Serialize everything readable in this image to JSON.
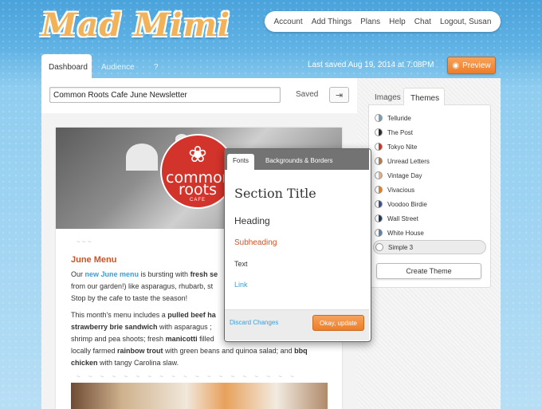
{
  "app": {
    "logo": "Mad Mimi"
  },
  "topnav": [
    "Account",
    "Add Things",
    "Plans",
    "Help",
    "Chat",
    "Logout, Susan"
  ],
  "tabs": {
    "dashboard": "Dashboard",
    "audience": "Audience",
    "help": "?"
  },
  "status": {
    "last_saved": "Last saved Aug 19, 2014 at 7:08PM",
    "preview": "Preview"
  },
  "editor": {
    "title_value": "Common Roots Cafe June Newsletter",
    "saved": "Saved",
    "exit_icon": "exit-icon"
  },
  "sidebar": {
    "tabs": [
      "Images",
      "Themes"
    ],
    "themes": [
      {
        "name": "Telluride",
        "color": "#7a9fb5"
      },
      {
        "name": "The Post",
        "color": "#2b2b2b"
      },
      {
        "name": "Tokyo Nite",
        "color": "#c0392b"
      },
      {
        "name": "Unread Letters",
        "color": "#b07a4a"
      },
      {
        "name": "Vintage Day",
        "color": "#d9b48a"
      },
      {
        "name": "Vivacious",
        "color": "#e67e22"
      },
      {
        "name": "Voodoo Birdie",
        "color": "#3d4e8a"
      },
      {
        "name": "Wall Street",
        "color": "#1f3a5a"
      },
      {
        "name": "White House",
        "color": "#5d7fa8"
      },
      {
        "name": "Simple 3",
        "color": "#ffffff"
      }
    ],
    "create_theme": "Create Theme"
  },
  "newsletter": {
    "logo_line1": "common",
    "logo_line2": "roots",
    "logo_line3": "CAFE",
    "date": "~    ~    ~",
    "heading": "June Menu",
    "p1": {
      "a": "Our ",
      "link": "new June menu",
      "b": " is bursting with ",
      "bold": "fresh se",
      "c": "from our garden!) like asparagus, rhubarb, st",
      "d": "Stop by the cafe to taste the season!"
    },
    "p2": {
      "a": "This month's menu includes a ",
      "b1": "pulled beef ha",
      "l2b": "strawberry brie sandwich",
      "l2c": " with asparagus ;",
      "l3": "shrimp and pea shoots; fresh ",
      "l3b": "manicotti",
      "l3c": " filled",
      "l4": "locally farmed ",
      "l4b": "rainbow trout",
      "l4c": " with green beans and quinoa salad; and ",
      "l4d": "bbq",
      "l5b": "chicken",
      "l5c": " with tangy Carolina slaw."
    },
    "divider": "~ ~ ~ ~ ~ ~ ~ ~ ~ ~ ~ ~ ~ ~ ~ ~ ~ ~ ~"
  },
  "popup": {
    "tabs": [
      "Fonts",
      "Backgrounds & Borders"
    ],
    "section_title": "Section Title",
    "heading": "Heading",
    "subheading": "Subheading",
    "text": "Text",
    "link": "Link",
    "discard": "Discard Changes",
    "ok": "Okay, update"
  },
  "colors": {
    "accent": "#ec7e2a",
    "link": "#3a9fd8",
    "subheading": "#d5501f"
  }
}
